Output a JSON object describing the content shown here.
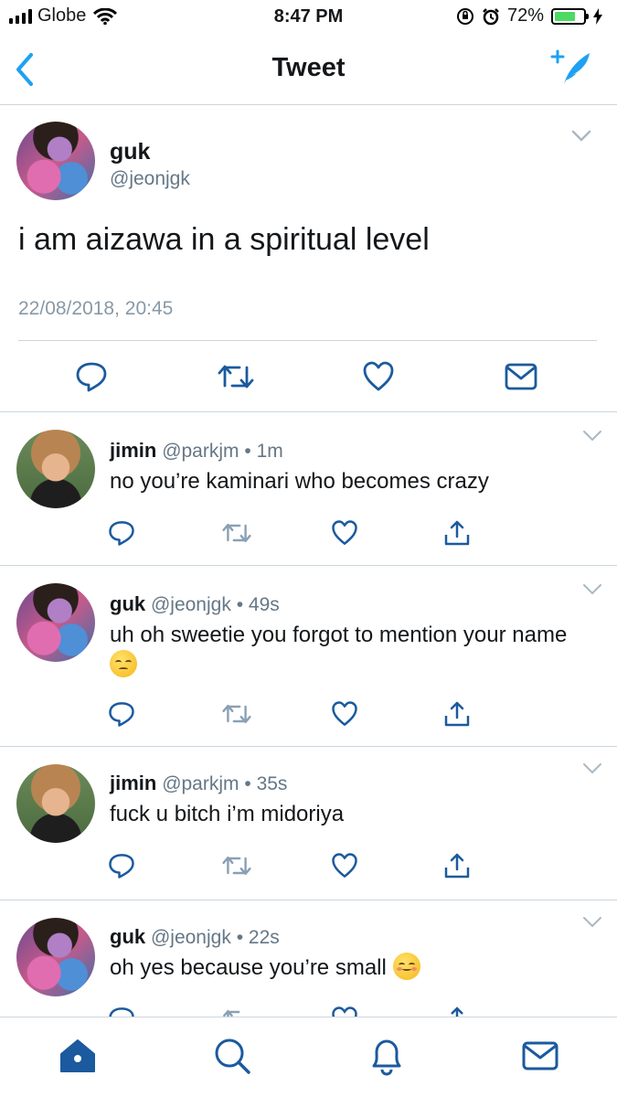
{
  "status_bar": {
    "carrier": "Globe",
    "time": "8:47 PM",
    "battery": "72%",
    "battery_level": 0.72
  },
  "nav": {
    "title": "Tweet"
  },
  "main_tweet": {
    "name": "guk",
    "handle": "@jeonjgk",
    "text": "i am aizawa in a spiritual level",
    "timestamp": "22/08/2018, 20:45"
  },
  "replies": [
    {
      "name": "jimin",
      "handle": "@parkjm",
      "dot": "•",
      "ago": "1m",
      "text": "no you’re kaminari who becomes crazy"
    },
    {
      "name": "guk",
      "handle": "@jeonjgk",
      "dot": "•",
      "ago": "49s",
      "text": "uh oh sweetie you forgot to mention your name",
      "emoji": "pensive-face"
    },
    {
      "name": "jimin",
      "handle": "@parkjm",
      "dot": "•",
      "ago": "35s",
      "text": "fuck u bitch i’m midoriya"
    },
    {
      "name": "guk",
      "handle": "@jeonjgk",
      "dot": "•",
      "ago": "22s",
      "text": "oh yes because you’re small",
      "emoji": "smiling-face"
    }
  ],
  "colors": {
    "accent": "#1da1f2",
    "nav_blue": "#1b5a9e",
    "secondary_text": "#657786",
    "divider": "#ccd6dd"
  },
  "icons": {
    "nav": [
      "back-chevron-icon",
      "compose-tweet-icon"
    ],
    "actions": [
      "reply-icon",
      "retweet-icon",
      "like-icon",
      "share-icon",
      "direct-message-icon"
    ],
    "tabs": [
      "home-icon",
      "search-icon",
      "notifications-icon",
      "messages-icon"
    ]
  }
}
